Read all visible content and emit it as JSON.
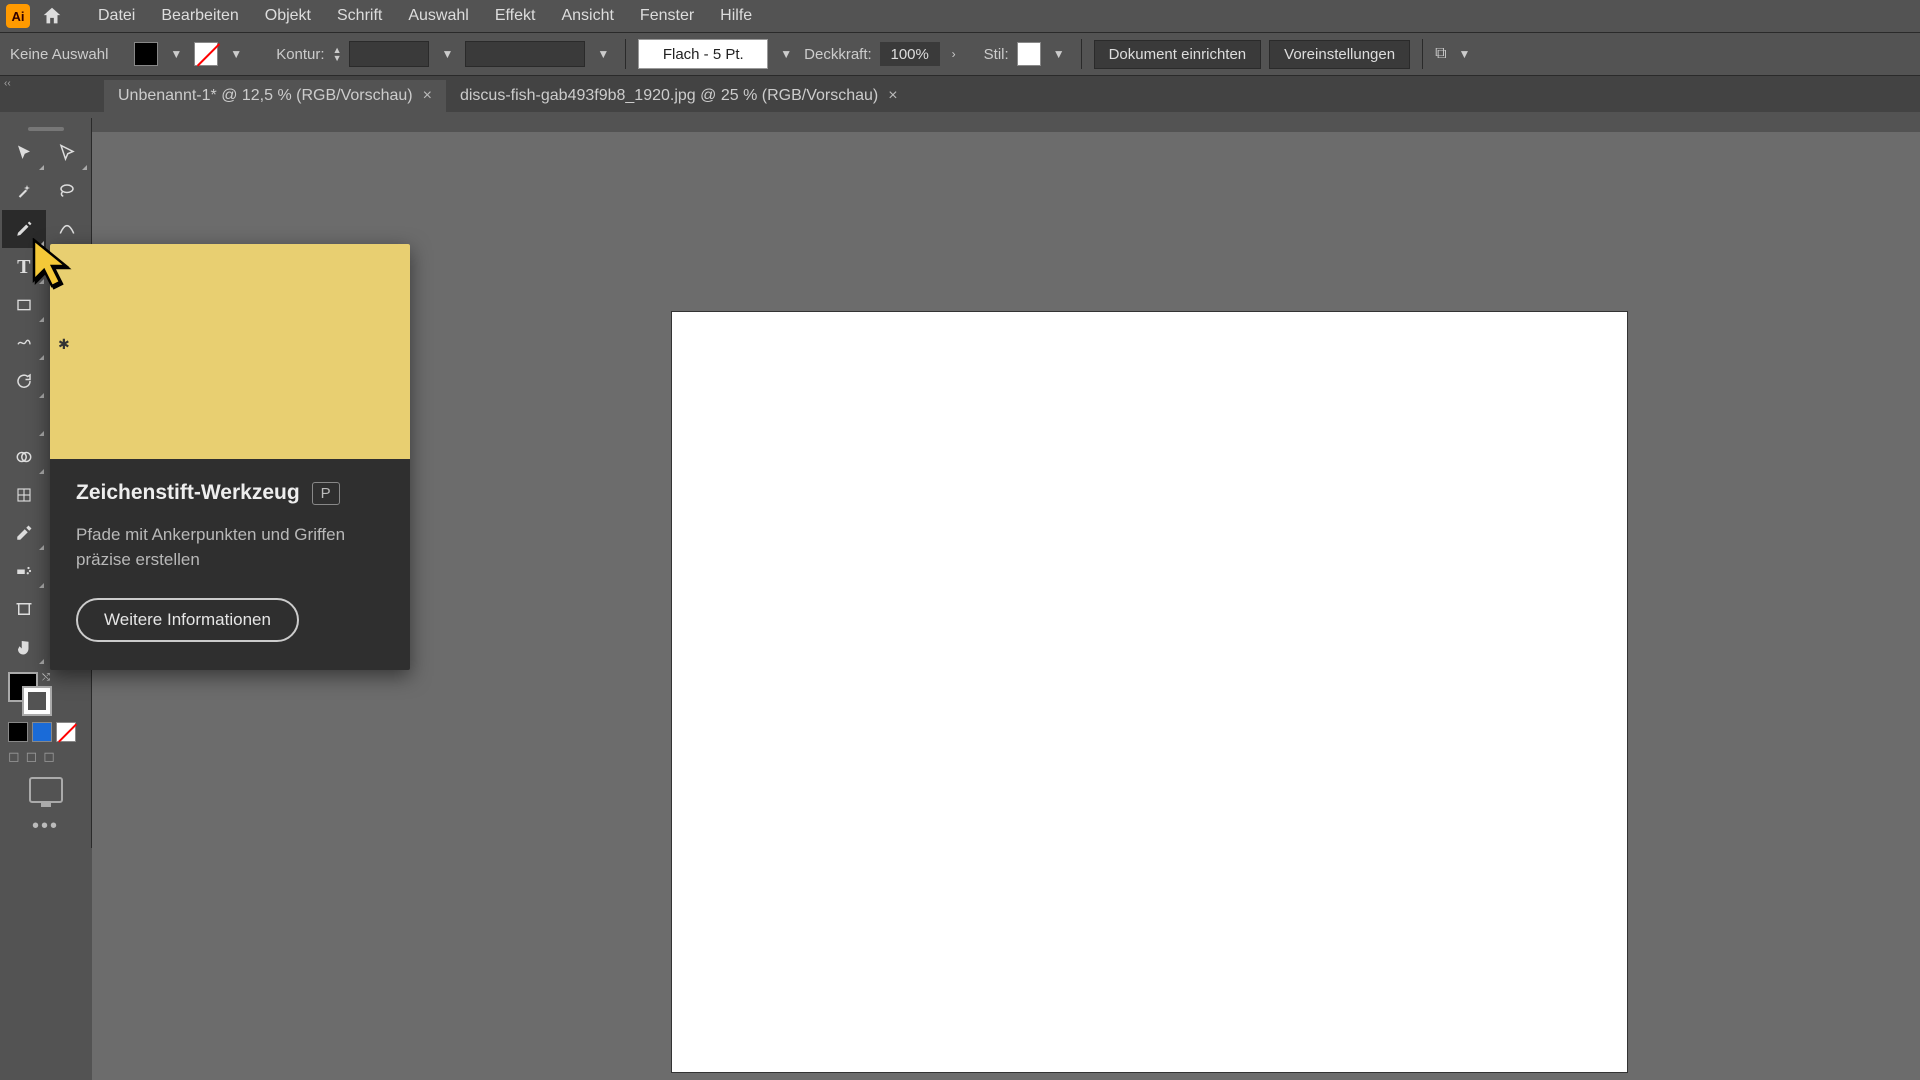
{
  "menubar": {
    "items": [
      "Datei",
      "Bearbeiten",
      "Objekt",
      "Schrift",
      "Auswahl",
      "Effekt",
      "Ansicht",
      "Fenster",
      "Hilfe"
    ]
  },
  "controlbar": {
    "selection_label": "Keine Auswahl",
    "stroke_label": "Kontur:",
    "brush_value": "Flach - 5 Pt.",
    "opacity_label": "Deckkraft:",
    "opacity_value": "100%",
    "style_label": "Stil:",
    "doc_setup_btn": "Dokument einrichten",
    "prefs_btn": "Voreinstellungen"
  },
  "tabs": [
    {
      "label": "Unbenannt-1* @ 12,5 % (RGB/Vorschau)",
      "active": true
    },
    {
      "label": "discus-fish-gab493f9b8_1920.jpg @ 25 % (RGB/Vorschau)",
      "active": false
    }
  ],
  "tooltip": {
    "title": "Zeichenstift-Werkzeug",
    "shortcut": "P",
    "description": "Pfade mit Ankerpunkten und Griffen präzise erstellen",
    "learn_more": "Weitere Informationen"
  },
  "colors": {
    "tooltip_thumb": "#e8cf71"
  }
}
